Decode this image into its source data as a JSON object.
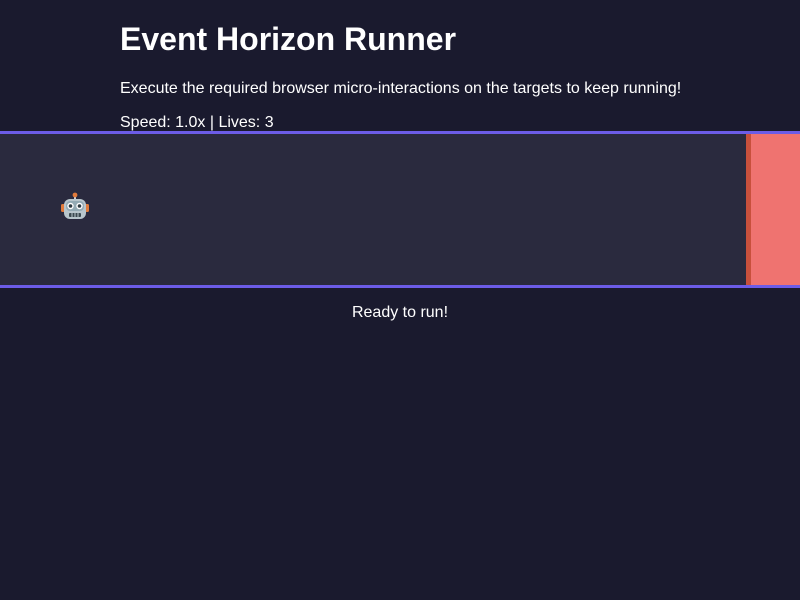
{
  "game": {
    "title": "Event Horizon Runner",
    "instructions": "Execute the required browser micro-interactions on the targets to keep running!",
    "stats": "Speed: 1.0x | Lives: 3",
    "status": "Ready to run!"
  },
  "track": {
    "player_icon": "robot-icon",
    "obstacle_color": "#ef7370",
    "accent_color": "#6c5ce7"
  },
  "colors": {
    "background": "#1a1a2e",
    "track_background": "#2a2a3e",
    "text": "#ffffff"
  }
}
